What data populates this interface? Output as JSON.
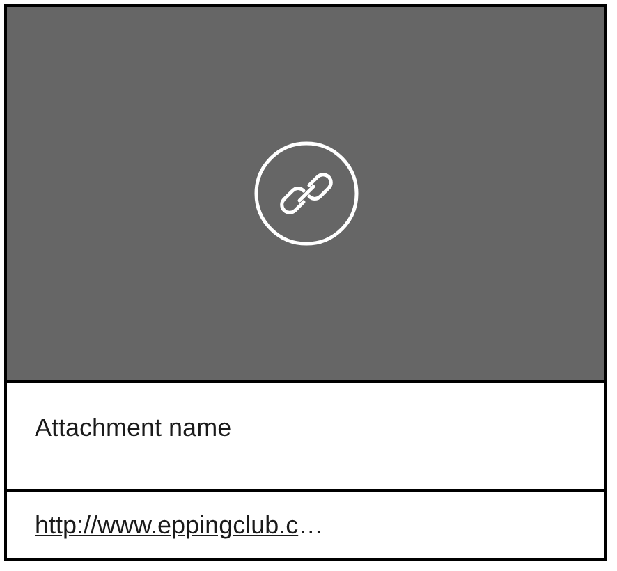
{
  "preview": {
    "kind": "link"
  },
  "attachment_name": "Attachment name",
  "link": {
    "text": "http://www.eppingclub.c",
    "ellipsis": "…"
  }
}
